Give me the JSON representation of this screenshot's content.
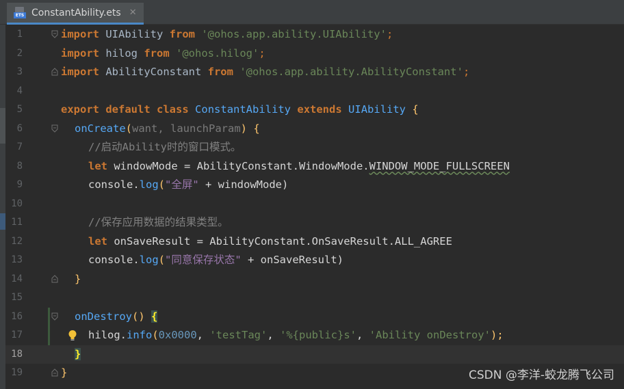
{
  "tab": {
    "title": "ConstantAbility.ets",
    "badge": "ETS",
    "close": "✕"
  },
  "editor": {
    "current_line": 18,
    "lines": [
      {
        "n": "1"
      },
      {
        "n": "2"
      },
      {
        "n": "3"
      },
      {
        "n": "4"
      },
      {
        "n": "5"
      },
      {
        "n": "6"
      },
      {
        "n": "7"
      },
      {
        "n": "8"
      },
      {
        "n": "9"
      },
      {
        "n": "10"
      },
      {
        "n": "11"
      },
      {
        "n": "12"
      },
      {
        "n": "13"
      },
      {
        "n": "14"
      },
      {
        "n": "15"
      },
      {
        "n": "16"
      },
      {
        "n": "17"
      },
      {
        "n": "18"
      },
      {
        "n": "19"
      }
    ],
    "tokens": {
      "l1": [
        "import",
        " UIAbility ",
        "from",
        " ",
        "'@ohos.app.ability.UIAbility'",
        ";"
      ],
      "l2": [
        "import",
        " hilog ",
        "from",
        " ",
        "'@ohos.hilog'",
        ";"
      ],
      "l3": [
        "import",
        " AbilityConstant ",
        "from",
        " ",
        "'@ohos.app.ability.AbilityConstant'",
        ";"
      ],
      "l5": [
        "export",
        " ",
        "default",
        " ",
        "class",
        " ",
        "ConstantAbility",
        " ",
        "extends",
        " ",
        "UIAbility",
        " {"
      ],
      "l6": [
        "onCreate",
        "(",
        "want",
        ", ",
        "launchParam",
        ") {"
      ],
      "l7": [
        "//启动Ability时的窗口模式。"
      ],
      "l8": [
        "let",
        " windowMode = AbilityConstant.WindowMode.",
        "WINDOW_MODE_FULLSCREEN"
      ],
      "l9": [
        "console.",
        "log",
        "(",
        "\"全屏\"",
        " + windowMode)"
      ],
      "l11": [
        "//保存应用数据的结果类型。"
      ],
      "l12": [
        "let",
        " onSaveResult = AbilityConstant.OnSaveResult.ALL_AGREE"
      ],
      "l13": [
        "console.",
        "log",
        "(",
        "\"同意保存状态\"",
        " + onSaveResult)"
      ],
      "l14": [
        "}"
      ],
      "l16": [
        "onDestroy",
        "() ",
        "{"
      ],
      "l17": [
        "hilog.",
        "info",
        "(",
        "0x0000",
        ", ",
        "'testTag'",
        ", ",
        "'%{public}s'",
        ", ",
        "'Ability onDestroy'",
        ");"
      ],
      "l18": [
        "}"
      ],
      "l19": [
        "}"
      ]
    }
  },
  "watermark": "CSDN @李洋-蛟龙腾飞公司",
  "icons": {
    "bulb": "lightbulb-icon",
    "fold": "fold-marker-icon",
    "file": "ets-file-icon"
  },
  "colors": {
    "background": "#2b2b2b",
    "keyword": "#cc7832",
    "string": "#6a8759",
    "function": "#ffc66d",
    "comment": "#808080",
    "number": "#6897bb",
    "accent": "#4a88c7"
  }
}
